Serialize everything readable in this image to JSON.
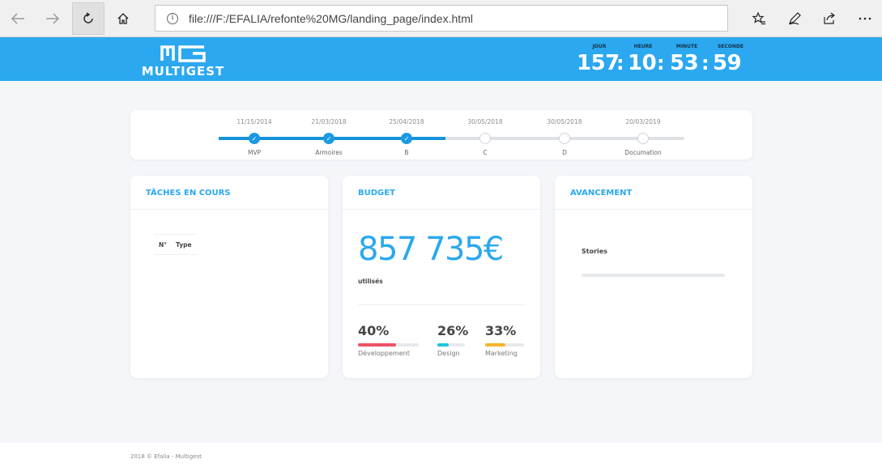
{
  "browser": {
    "url": "file:///F:/EFALIA/refonte%20MG/landing_page/index.html",
    "info_glyph": "i",
    "icons": [
      "back-icon",
      "forward-icon",
      "refresh-icon",
      "home-icon",
      "favorites-icon",
      "pen-icon",
      "share-icon",
      "more-icon"
    ]
  },
  "header": {
    "logo_mark": "MG",
    "logo_word": "MULTIGEST",
    "countdown": {
      "labels": {
        "day": "JOUR",
        "hour": "HEURE",
        "minute": "MINUTE",
        "second": "SECONDE"
      },
      "values": {
        "day": "157",
        "hour": "10",
        "minute": "53",
        "second": "59"
      },
      "separator": ":"
    }
  },
  "timeline": {
    "milestones": [
      {
        "date": "11/15/2014",
        "name": "MVP",
        "done": true
      },
      {
        "date": "21/03/2018",
        "name": "Armoires",
        "done": true
      },
      {
        "date": "25/04/2018",
        "name": "B",
        "done": true
      },
      {
        "date": "30/05/2018",
        "name": "C",
        "done": false
      },
      {
        "date": "30/05/2018",
        "name": "D",
        "done": false
      },
      {
        "date": "20/03/2019",
        "name": "Documation",
        "done": false
      }
    ]
  },
  "tasks": {
    "title": "TÂCHES EN COURS",
    "columns": [
      "N°",
      "Type"
    ]
  },
  "budget": {
    "title": "BUDGET",
    "amount": "857 735€",
    "caption": "utilisés",
    "breakdown": [
      {
        "pct": "40%",
        "label": "Développement",
        "fill": 0.62,
        "color": "#ee5167"
      },
      {
        "pct": "26%",
        "label": "Design",
        "fill": 0.4,
        "color": "#1fc4d8"
      },
      {
        "pct": "33%",
        "label": "Marketing",
        "fill": 0.52,
        "color": "#f3b52b"
      }
    ]
  },
  "progress": {
    "title": "AVANCEMENT",
    "label": "Stories",
    "fill": 0
  },
  "footer": {
    "text": "2018 © Efalia - Multigest"
  }
}
